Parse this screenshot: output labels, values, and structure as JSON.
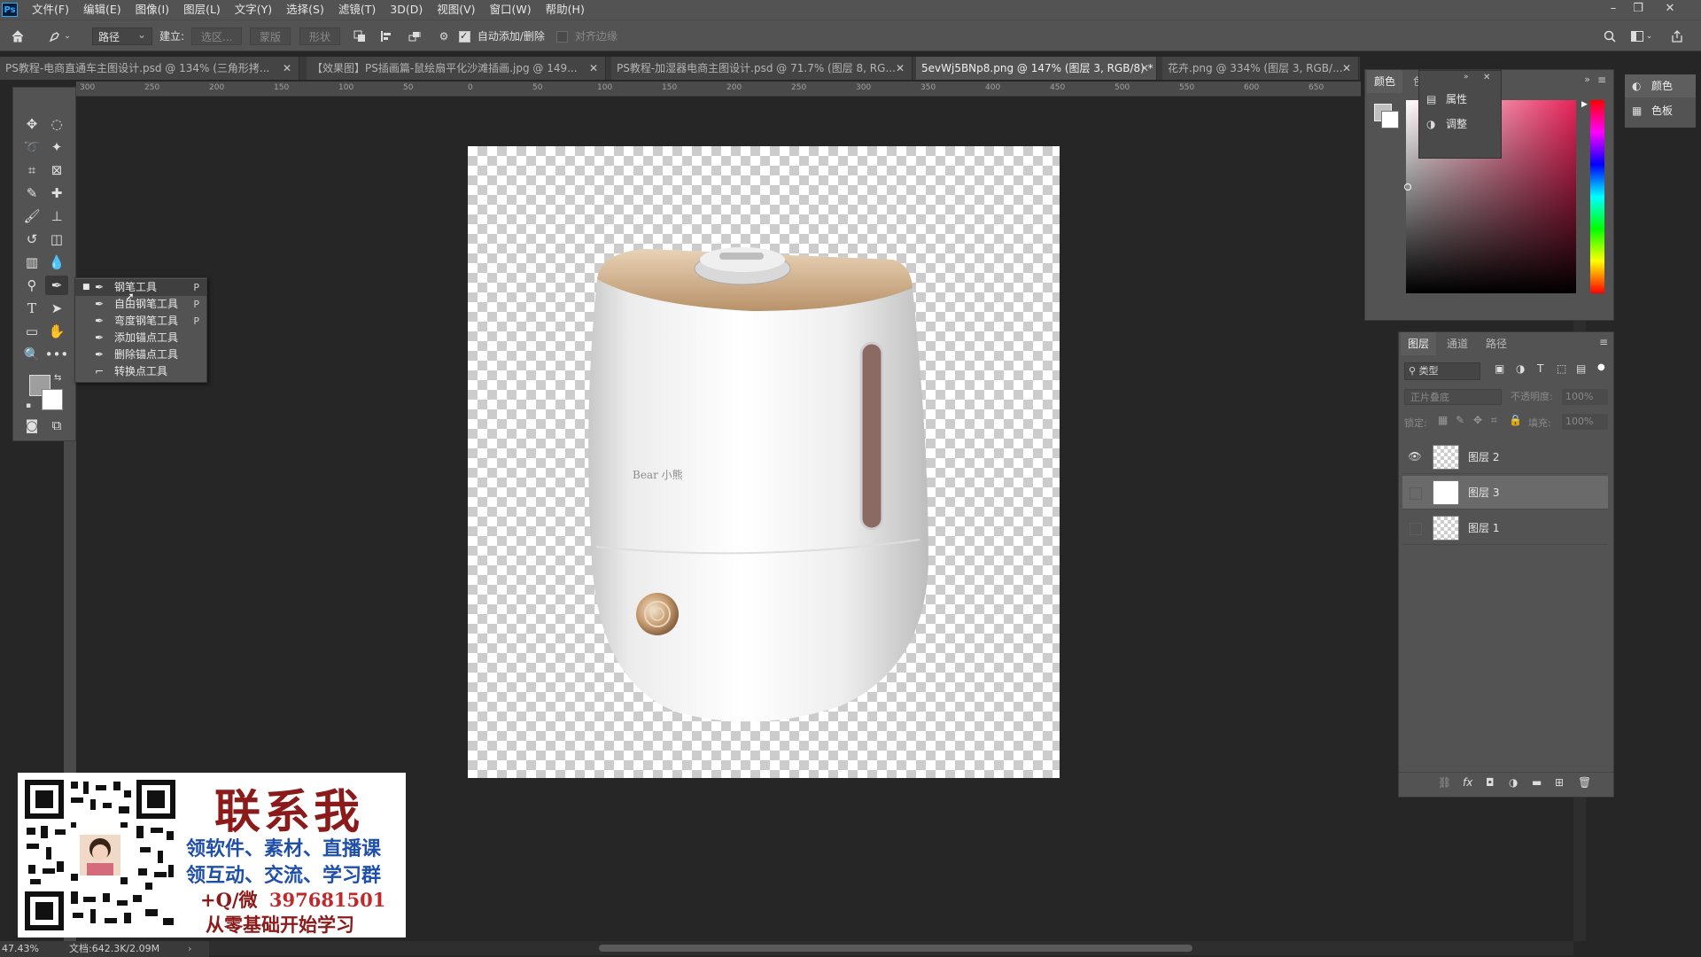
{
  "menubar": {
    "logo": "Ps",
    "items": [
      "文件(F)",
      "编辑(E)",
      "图像(I)",
      "图层(L)",
      "文字(Y)",
      "选择(S)",
      "滤镜(T)",
      "3D(D)",
      "视图(V)",
      "窗口(W)",
      "帮助(H)"
    ],
    "window_controls": [
      "–",
      "❐",
      "✕"
    ]
  },
  "options": {
    "mode_select": "路径",
    "make_label": "建立:",
    "selection_btn": "选区...",
    "mask_btn": "蒙版",
    "shape_btn": "形状",
    "auto_add_delete": "自动添加/删除",
    "align_edges": "对齐边缘"
  },
  "tabs": [
    {
      "title": "PS教程-电商直通车主图设计.psd @ 134% (三角形拷...",
      "close": "✕"
    },
    {
      "title": "【效果图】PS插画篇-鼠绘扇平化沙滩插画.jpg @ 149...",
      "close": "✕"
    },
    {
      "title": "PS教程-加湿器电商主图设计.psd @ 71.7% (图层 8, RG...",
      "close": "✕"
    },
    {
      "title": "5evWj5BNp8.png @ 147% (图层 3, RGB/8) *",
      "close": "✕"
    },
    {
      "title": "花卉.png @ 334% (图层 3, RGB/...",
      "close": "✕"
    }
  ],
  "ruler_ticks": [
    "300",
    "250",
    "200",
    "150",
    "100",
    "50",
    "0",
    "50",
    "100",
    "150",
    "200",
    "250",
    "300",
    "350",
    "400",
    "450",
    "500",
    "550",
    "600",
    "650"
  ],
  "flyout": {
    "items": [
      {
        "label": "钢笔工具",
        "key": "P",
        "icon": "pen-icon",
        "selected": true
      },
      {
        "label": "自由钢笔工具",
        "key": "P",
        "icon": "freeform-pen-icon"
      },
      {
        "label": "弯度钢笔工具",
        "key": "P",
        "icon": "curvature-pen-icon"
      },
      {
        "label": "添加锚点工具",
        "key": "",
        "icon": "add-anchor-icon"
      },
      {
        "label": "删除锚点工具",
        "key": "",
        "icon": "delete-anchor-icon"
      },
      {
        "label": "转换点工具",
        "key": "",
        "icon": "convert-point-icon"
      }
    ]
  },
  "product": {
    "brand_text": "Bear 小熊"
  },
  "promo": {
    "title": "联系我",
    "line1": "领软件、素材、直播课",
    "line2": "领互动、交流、学习群",
    "contact_prefix": "+Q/微",
    "contact_number": "397681501",
    "line4": "从零基础开始学习"
  },
  "status": {
    "zoom": "47.43%",
    "doc": "文档:642.3K/2.09M"
  },
  "color_panel": {
    "tabs": [
      "颜色",
      "色板"
    ],
    "popup_items": [
      "属性",
      "调整"
    ]
  },
  "side_panel": {
    "items": [
      "颜色",
      "色板"
    ]
  },
  "layers_panel": {
    "tabs": [
      "图层",
      "通道",
      "路径"
    ],
    "kind_filter": "类型",
    "blend_mode": "正片叠底",
    "opacity_label": "不透明度:",
    "opacity_value": "100%",
    "lock_label": "锁定:",
    "fill_label": "填充:",
    "fill_value": "100%",
    "layers": [
      {
        "name": "图层 2",
        "visible": true
      },
      {
        "name": "图层 3",
        "visible": false,
        "selected": true
      },
      {
        "name": "图层 1",
        "visible": false
      }
    ]
  },
  "colors": {
    "accent": "#31a8ff",
    "promo_red": "#8b1a1a",
    "promo_blue": "#1f4fa8"
  }
}
